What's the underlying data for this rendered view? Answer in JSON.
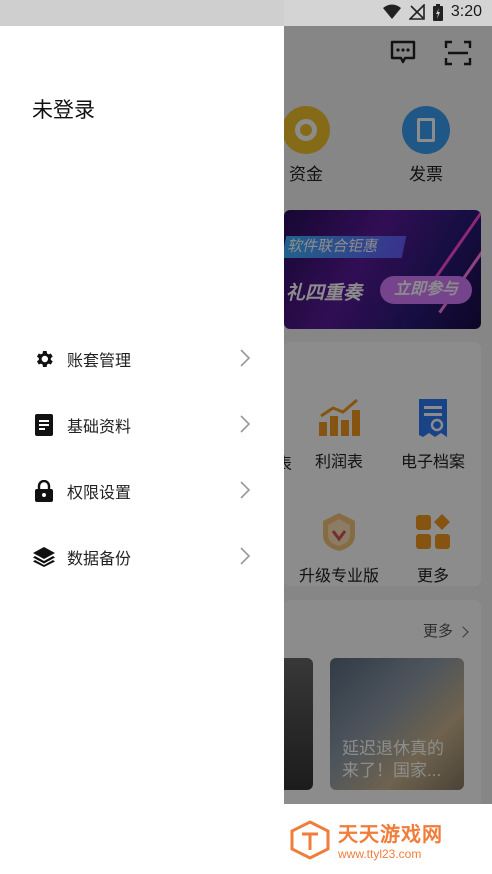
{
  "status_bar": {
    "time": "3:20"
  },
  "drawer": {
    "user_label": "未登录",
    "menu": [
      {
        "label": "账套管理",
        "icon": "gear-icon"
      },
      {
        "label": "基础资料",
        "icon": "document-icon"
      },
      {
        "label": "权限设置",
        "icon": "lock-icon"
      },
      {
        "label": "数据备份",
        "icon": "layers-icon"
      }
    ]
  },
  "background": {
    "quick_actions": [
      {
        "label": "资金",
        "color": "#f3c22d"
      },
      {
        "label": "发票",
        "color": "#3a9ff5"
      }
    ],
    "banner": {
      "line1": "软件联合钜惠",
      "line2": "礼四重奏",
      "button": "立即参与"
    },
    "grid": [
      {
        "label": "利润表"
      },
      {
        "label": "电子档案"
      },
      {
        "label": "升级专业版"
      },
      {
        "label": "更多"
      }
    ],
    "partial_label": "表",
    "news": {
      "more_label": "更多",
      "article_title": "延迟退休真的来了！国家..."
    }
  },
  "watermark": {
    "name": "天天游戏网",
    "url": "www.ttyl23.com"
  },
  "colors": {
    "accent": "#f39a1e",
    "blue": "#2d7df6"
  }
}
